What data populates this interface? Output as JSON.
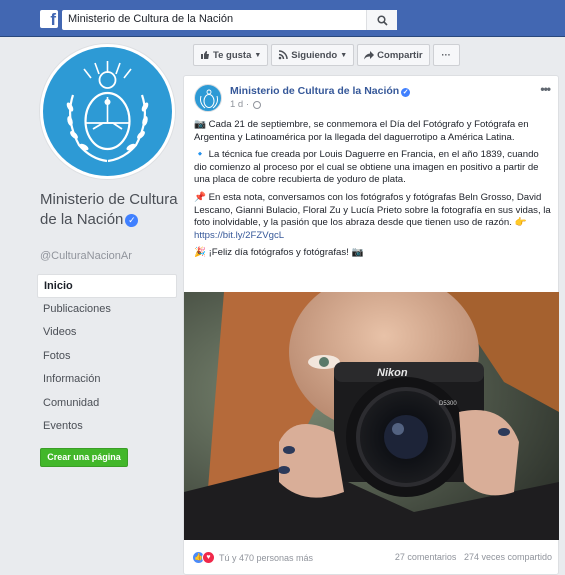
{
  "header": {
    "search_value": "Ministerio de Cultura de la Nación",
    "logo_letter": "f"
  },
  "page": {
    "name": "Ministerio de Cultura de la Nación",
    "handle": "@CulturaNacionAr"
  },
  "nav": [
    {
      "label": "Inicio",
      "active": true
    },
    {
      "label": "Publicaciones"
    },
    {
      "label": "Videos"
    },
    {
      "label": "Fotos"
    },
    {
      "label": "Información"
    },
    {
      "label": "Comunidad"
    },
    {
      "label": "Eventos"
    }
  ],
  "create_page_label": "Crear una página",
  "actions": {
    "like": "Te gusta",
    "following": "Siguiendo",
    "share": "Compartir",
    "more": "···"
  },
  "post": {
    "author": "Ministerio de Cultura de la Nación",
    "time": "1 d ·",
    "options": "•••",
    "paragraphs": {
      "p1": "📷 Cada 21 de septiembre, se conmemora el Día del Fotógrafo y Fotógrafa en Argentina y Latinoamérica por la llegada del daguerrotipo a América Latina.",
      "p2": "🔹 La técnica fue creada por Louis Daguerre en Francia, en el año 1839, cuando dio comienzo al proceso por el cual se obtiene una imagen en positivo a partir de una placa de cobre recubierta de yoduro de plata.",
      "p3_text": "📌 En esta nota, conversamos con los fotógrafos y fotógrafas Beln Grosso, David Lescano, Gianni Bulacio, Floral Zu y Lucía Prieto sobre la fotografía en sus vidas, la foto inolvidable, y la pasión que los abraza desde que tienen uso de razón. 👉",
      "p3_link": "https://bit.ly/2FZVgcL",
      "p4": "🎉 ¡Feliz día fotógrafos y fotógrafas! 📷"
    },
    "camera_brand": "Nikon",
    "camera_model": "D5300",
    "reactions_text": "Tú y 470 personas más",
    "comments": "27 comentarios",
    "shares": "274 veces compartido"
  }
}
